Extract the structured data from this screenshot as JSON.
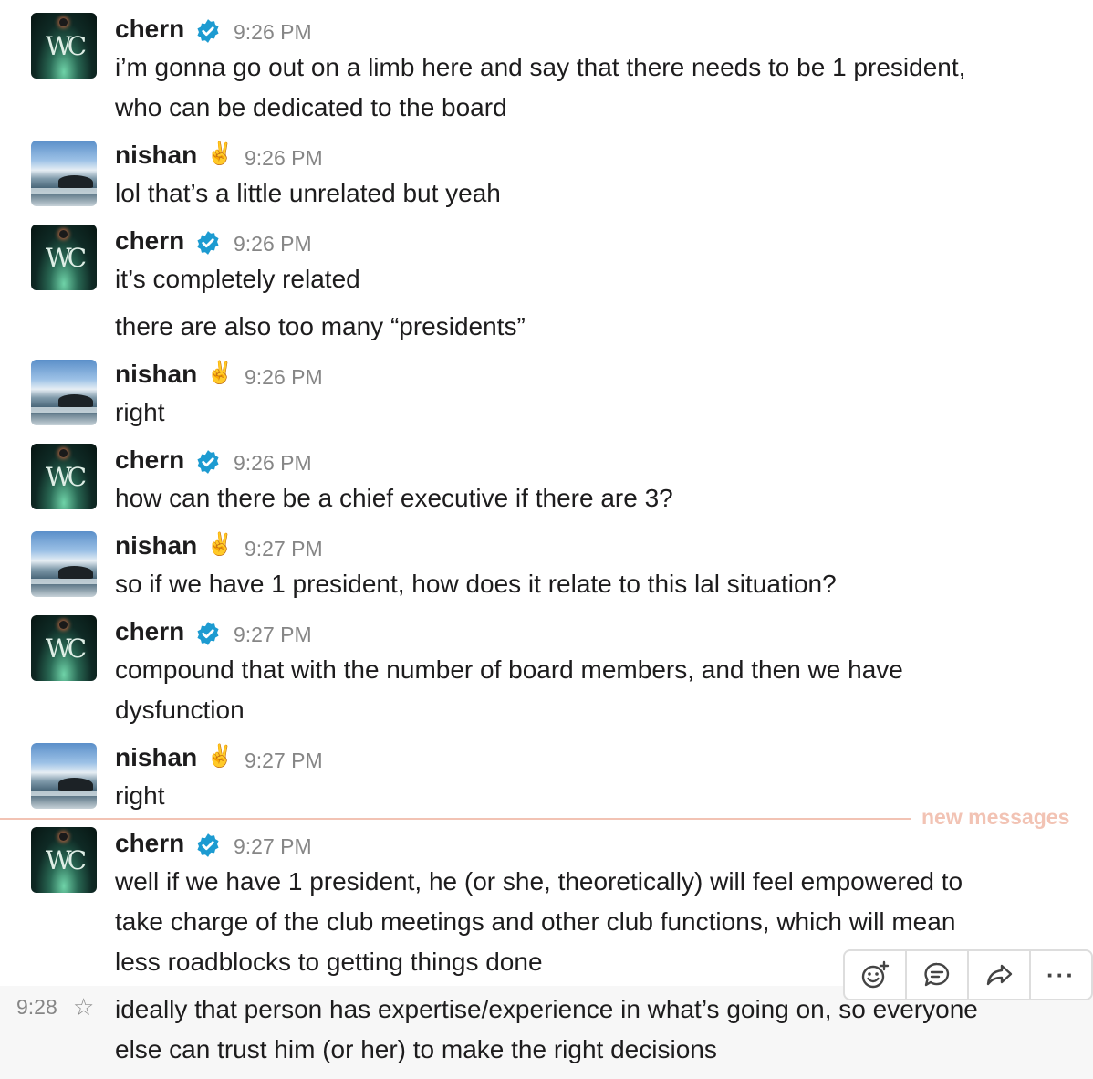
{
  "messages": [
    {
      "author": "chern",
      "badge": "verified",
      "time": "9:26 PM",
      "lines": [
        "i’m gonna go out on a limb here and say that there needs to be 1 president,",
        "who can be dedicated to the board"
      ]
    },
    {
      "author": "nishan",
      "badge": "✌️",
      "time": "9:26 PM",
      "lines": [
        "lol that’s a little unrelated but yeah"
      ]
    },
    {
      "author": "chern",
      "badge": "verified",
      "time": "9:26 PM",
      "lines": [
        "it’s completely related"
      ],
      "followup": "there are also too many “presidents”"
    },
    {
      "author": "nishan",
      "badge": "✌️",
      "time": "9:26 PM",
      "lines": [
        "right"
      ]
    },
    {
      "author": "chern",
      "badge": "verified",
      "time": "9:26 PM",
      "lines": [
        "how can there be a chief executive if there are 3?"
      ]
    },
    {
      "author": "nishan",
      "badge": "✌️",
      "time": "9:27 PM",
      "lines": [
        "so if we have 1 president, how does it relate to this lal situation?"
      ]
    },
    {
      "author": "chern",
      "badge": "verified",
      "time": "9:27 PM",
      "lines": [
        "compound that with the number of board members, and then we have",
        "dysfunction"
      ]
    },
    {
      "author": "nishan",
      "badge": "✌️",
      "time": "9:27 PM",
      "lines": [
        "right"
      ]
    },
    {
      "author": "chern",
      "badge": "verified",
      "time": "9:27 PM",
      "lines": [
        "well if we have 1 president, he (or she, theoretically) will feel empowered to",
        "take charge of the club meetings and other club functions, which will mean",
        "less roadblocks to getting things done"
      ]
    }
  ],
  "avatar_monogram": "WC",
  "divider_label": "new messages",
  "hovered": {
    "time": "9:28",
    "lines": [
      "ideally that person has expertise/experience in what’s going on, so everyone",
      "else can trust him (or her) to make the right decisions"
    ]
  },
  "toolbar": {
    "icons": [
      "add-reaction-icon",
      "thread-icon",
      "share-icon",
      "more-icon"
    ],
    "more_glyph": "···"
  },
  "colors": {
    "divider": "#f2c3b4",
    "verified": "#1d9bd1",
    "time": "#868686"
  }
}
